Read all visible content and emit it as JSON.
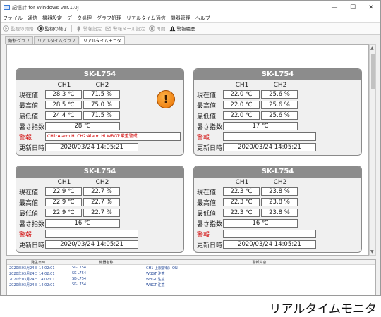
{
  "window": {
    "title": "記憶計 for Windows Ver.1.0J",
    "controls": [
      "—",
      "☐",
      "✕"
    ]
  },
  "menubar": [
    "ファイル",
    "通信",
    "機器設定",
    "データ処理",
    "グラフ処理",
    "リアルタイム通信",
    "機器管理",
    "ヘルプ"
  ],
  "toolbar": [
    {
      "label": "監視の開始",
      "icon": "play-icon",
      "enabled": false
    },
    {
      "label": "監視の終了",
      "icon": "stop-icon",
      "enabled": true
    },
    {
      "label": "警報設定",
      "icon": "bell-icon",
      "enabled": false
    },
    {
      "label": "警報メール設定",
      "icon": "mail-icon",
      "enabled": false
    },
    {
      "label": "再開",
      "icon": "resume-icon",
      "enabled": false
    },
    {
      "label": "警報履歴",
      "icon": "warning-icon",
      "enabled": true
    }
  ],
  "tabs": [
    "解析グラフ",
    "リアルタイムグラフ",
    "リアルタイムモニタ"
  ],
  "labels": {
    "ch1": "CH1",
    "ch2": "CH2",
    "current": "現在値",
    "max": "最高値",
    "min": "最低値",
    "wbgt": "暑さ指数",
    "alarm": "警報",
    "updated": "更新日時"
  },
  "panels": [
    {
      "model": "SK-L754",
      "ch1_cur": "28.3 ℃",
      "ch2_cur": "71.5 %",
      "ch1_max": "28.5 ℃",
      "ch2_max": "75.0 %",
      "ch1_min": "24.4 ℃",
      "ch2_min": "71.5 %",
      "wbgt": "28 ℃",
      "alarm": "CH1:Alarm Hi CH2:Alarm Hi WBGT:厳重警戒",
      "updated": "2020/03/24 14:05:21",
      "warn": "!"
    },
    {
      "model": "SK-L754",
      "ch1_cur": "22.0 ℃",
      "ch2_cur": "25.6 %",
      "ch1_max": "22.0 ℃",
      "ch2_max": "25.6 %",
      "ch1_min": "22.0 ℃",
      "ch2_min": "25.6 %",
      "wbgt": "17 ℃",
      "alarm": "",
      "updated": "2020/03/24 14:05:21"
    },
    {
      "model": "SK-L754",
      "ch1_cur": "22.9 ℃",
      "ch2_cur": "22.7 %",
      "ch1_max": "22.9 ℃",
      "ch2_max": "22.7 %",
      "ch1_min": "22.9 ℃",
      "ch2_min": "22.7 %",
      "wbgt": "16 ℃",
      "alarm": "",
      "updated": "2020/03/24 14:05:21"
    },
    {
      "model": "SK-L754",
      "ch1_cur": "22.3 ℃",
      "ch2_cur": "23.8 %",
      "ch1_max": "22.3 ℃",
      "ch2_max": "23.8 %",
      "ch1_min": "22.3 ℃",
      "ch2_min": "23.8 %",
      "wbgt": "16 ℃",
      "alarm": "",
      "updated": "2020/03/24 14:05:21"
    }
  ],
  "log": {
    "headers": [
      "発生日時",
      "機器名称",
      "警報内容"
    ],
    "rows": [
      [
        "2020年03月24日 14:02:01",
        "SK-L754",
        "CH1 上限警報：ON"
      ],
      [
        "2020年03月24日 14:02:01",
        "SK-L754",
        "WBGT 注意"
      ],
      [
        "2020年03月24日 14:02:01",
        "SK-L754",
        "WBGT 注意"
      ],
      [
        "2020年03月24日 14:02:01",
        "SK-L754",
        "WBGT 注意"
      ]
    ]
  },
  "caption": "リアルタイムモニタ"
}
